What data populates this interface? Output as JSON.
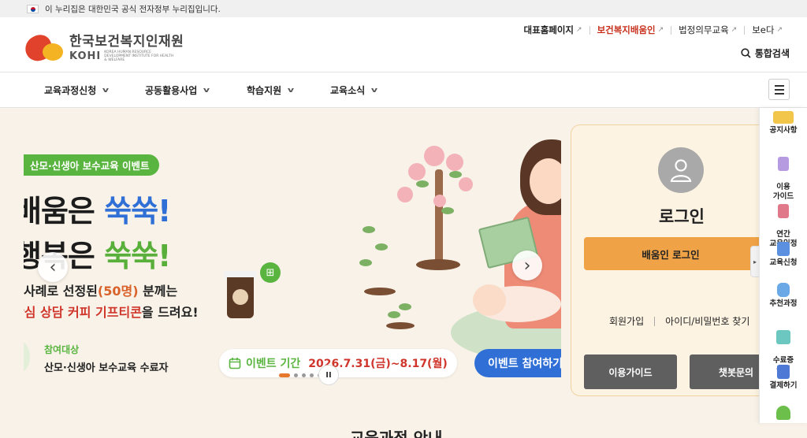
{
  "gov_banner": {
    "text": "이 누리집은 대한민국 공식 전자정부 누리집입니다."
  },
  "logo": {
    "name_ko": "한국보건복지인재원",
    "abbr": "KOHI",
    "name_en": "KOREA HUMAN RESOURCE DEVELOPMENT INSTITUTE FOR HEALTH & WELFARE"
  },
  "util_links": [
    {
      "label": "대표홈페이지"
    },
    {
      "label": "보건복지배움인"
    },
    {
      "label": "법정의무교육"
    },
    {
      "label": "보e다"
    }
  ],
  "search": {
    "label": "통합검색"
  },
  "gnb": [
    {
      "label": "교육과정신청"
    },
    {
      "label": "공동활용사업"
    },
    {
      "label": "학습지원"
    },
    {
      "label": "교육소식"
    }
  ],
  "banner": {
    "tag": "산모·신생아 보수교육 이벤트",
    "line1_a": "배움은 ",
    "line1_b": "쑥쑥!",
    "line2_a": "행복은 ",
    "line2_b": "쑥쑥!",
    "desc1_a": "사례로 선정된",
    "desc1_b": "(50명)",
    "desc1_c": " 분께는",
    "desc2_a": "안심 상담 커피 기프티콘",
    "desc2_b": "을 드려요!",
    "target_label": "참여대상",
    "target_text": "산모·신생아 보수교육 수료자",
    "period_label": "이벤트 기간",
    "period_dates": "2026.7.31(금)~8.17(월)",
    "cta": "이벤트 참여하기"
  },
  "login": {
    "title": "로그인",
    "button": "배움인 로그인",
    "signup": "회원가입",
    "find": "아이디/비밀번호 찾기",
    "guide": "이용가이드",
    "chatbot": "챗봇문의"
  },
  "quick_menu": [
    {
      "label": "공지사항",
      "color": "#f2c64a"
    },
    {
      "label": "이용\n가이드",
      "color": "#b79be0"
    },
    {
      "label": "연간\n교육일정",
      "color": "#e07a8a"
    },
    {
      "label": "교육신청",
      "color": "#5b8fe0"
    },
    {
      "label": "추천과정",
      "color": "#6aa8e6"
    },
    {
      "label": "수료증\n출력",
      "color": "#6cc7c0"
    },
    {
      "label": "결제하기",
      "color": "#4e7ad6"
    }
  ],
  "bottom_section": {
    "title": "교육과정 안내"
  },
  "colors": {
    "accent_orange": "#f0a346",
    "green": "#5ab540",
    "blue": "#2f6fd6",
    "red": "#d0352b"
  }
}
